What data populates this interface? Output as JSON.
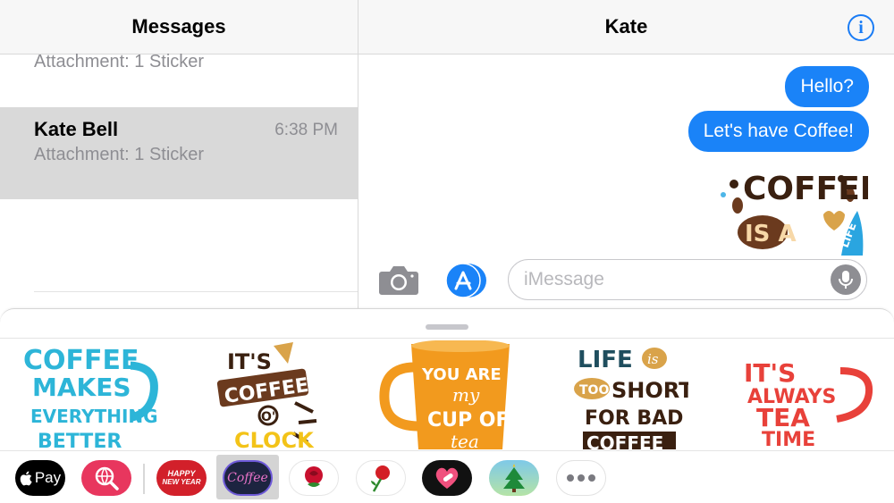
{
  "messages_list": {
    "title": "Messages",
    "partial_item_subtitle": "Attachment: 1 Sticker",
    "conversations": [
      {
        "name": "Kate Bell",
        "time": "6:38 PM",
        "subtitle": "Attachment: 1 Sticker"
      }
    ]
  },
  "conversation": {
    "contact_name": "Kate",
    "info_icon": "info-circle-icon",
    "messages": [
      {
        "text": "Hello?"
      },
      {
        "text": "Let's have Coffee!"
      }
    ],
    "sticker_message": {
      "line1": "COFFEE",
      "line2": "IS A",
      "line3": "LIFE"
    }
  },
  "compose": {
    "camera_icon": "camera-icon",
    "appstore_icon": "app-store-icon",
    "placeholder": "iMessage",
    "mic_icon": "microphone-icon"
  },
  "sticker_drawer": {
    "stickers": [
      {
        "lines": [
          "COFFEE",
          "MAKES",
          "EVERYTHING",
          "BETTER"
        ]
      },
      {
        "lines": [
          "IT'S",
          "COFFEE",
          "O'",
          "CLOCK"
        ]
      },
      {
        "lines": [
          "YOU ARE",
          "my",
          "CUP OF",
          "tea"
        ]
      },
      {
        "lines": [
          "LIFE",
          "is",
          "TOO",
          "SHORT",
          "FOR BAD",
          "COFFEE"
        ]
      },
      {
        "lines": [
          "IT'S",
          "ALWAYS",
          "TEA",
          "TIME"
        ]
      }
    ]
  },
  "app_tray": {
    "apple_pay_label": "Pay",
    "apps": [
      {
        "name": "apple-pay"
      },
      {
        "name": "web-search"
      },
      {
        "name": "happy-new-year",
        "label1": "HAPPY",
        "label2": "NEW YEAR"
      },
      {
        "name": "coffee",
        "label": "Coffee",
        "selected": true
      },
      {
        "name": "rose-sticker"
      },
      {
        "name": "rose-sticker-2"
      },
      {
        "name": "heart-sticker"
      },
      {
        "name": "christmas-tree"
      },
      {
        "name": "more"
      }
    ]
  },
  "colors": {
    "imessage_blue": "#1a83f8",
    "selected_row": "#d9d9d9",
    "secondary_text": "#8e8e93"
  }
}
